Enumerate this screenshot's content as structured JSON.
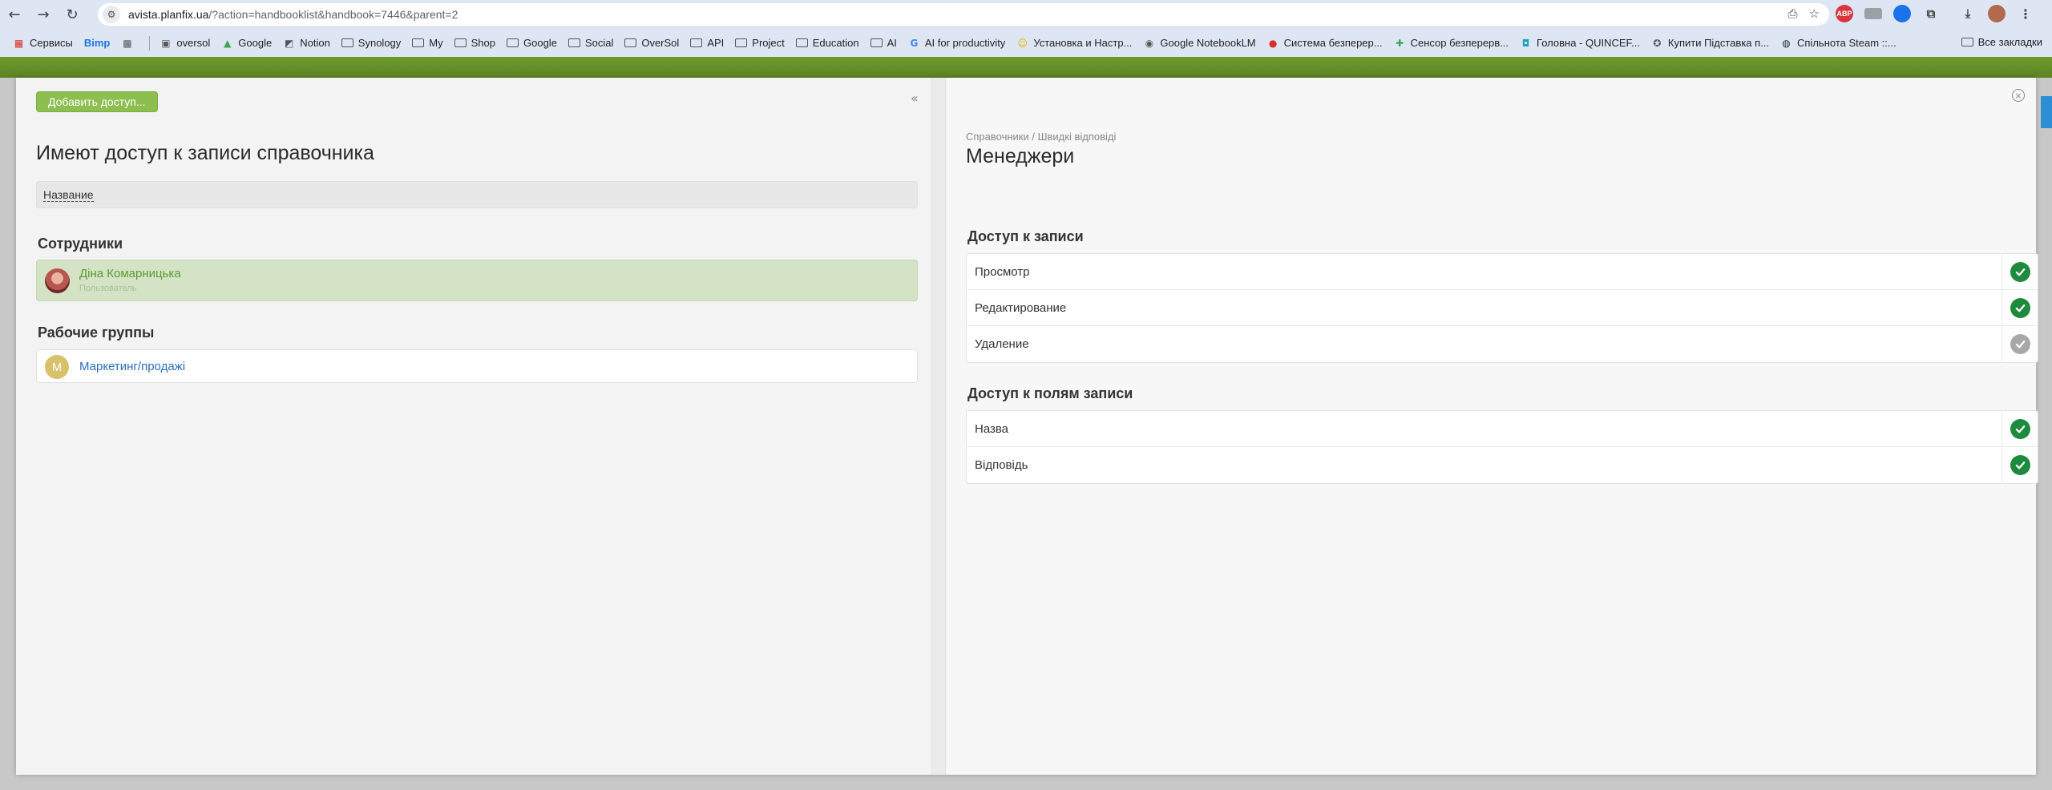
{
  "browser": {
    "url_host": "avista.planfix.ua",
    "url_path": "/?action=handbooklist&handbook=7446&parent=2",
    "nav_back": "←",
    "nav_forward": "→",
    "nav_reload": "↻",
    "ext_abp": "ABP"
  },
  "bookmarks": {
    "items": [
      "Сервисы",
      "Bimp",
      "oversol",
      "Google",
      "Notion",
      "Synology",
      "My",
      "Shop",
      "Google",
      "Social",
      "OverSol",
      "API",
      "Project",
      "Education",
      "AI",
      "AI for productivity",
      "Установка и Настр...",
      "Google NotebookLM",
      "Система безперер...",
      "Сенсор безперерв...",
      "Головна - QUINCEF...",
      "Купити Підставка п...",
      "Спільнота Steam ::..."
    ],
    "all_label": "Все закладки"
  },
  "left": {
    "add_button": "Добавить доступ...",
    "collapse": "«",
    "title": "Имеют доступ к записи справочника",
    "filter_label": "Название",
    "employees_heading": "Сотрудники",
    "employee_name": "Діна Комарницька",
    "employee_role": "Пользователь",
    "groups_heading": "Рабочие группы",
    "group_initial": "М",
    "group_name": "Маркетинг/продажі"
  },
  "right": {
    "close": "×",
    "breadcrumb": "Справочники / Швидкі відповіді",
    "title": "Менеджери",
    "record_access_heading": "Доступ к записи",
    "record_access": [
      {
        "label": "Просмотр",
        "state": "on"
      },
      {
        "label": "Редактирование",
        "state": "on"
      },
      {
        "label": "Удаление",
        "state": "off"
      }
    ],
    "field_access_heading": "Доступ к полям записи",
    "field_access": [
      {
        "label": "Назва",
        "state": "on"
      },
      {
        "label": "Відповідь",
        "state": "on"
      }
    ]
  },
  "colors": {
    "check_on": "#1e8a3e",
    "check_off": "#a8a8a8",
    "accent_green": "#8cbf4f"
  }
}
